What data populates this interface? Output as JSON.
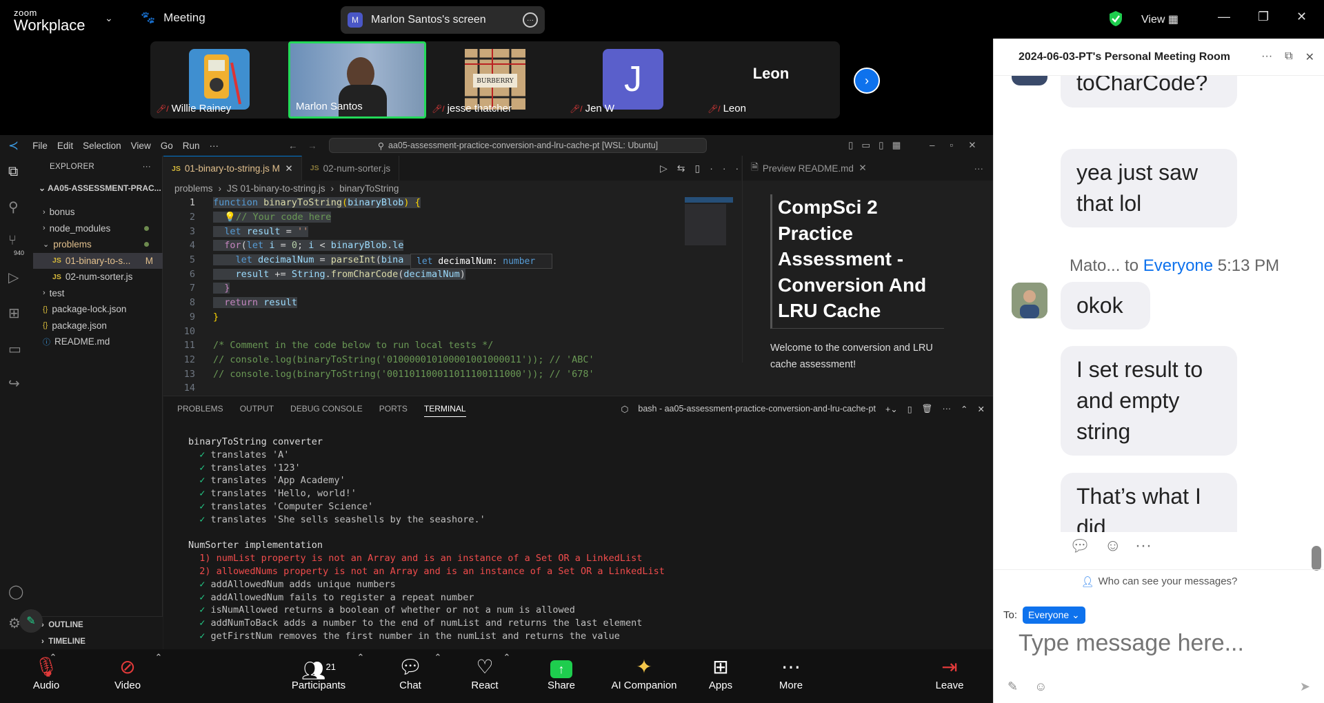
{
  "zoom": {
    "brand_top": "zoom",
    "brand_bottom": "Workplace",
    "meeting_label": "Meeting",
    "share_label": "Marlon Santos's screen",
    "share_avatar": "M",
    "view_label": "View"
  },
  "participants": [
    {
      "name": "Willie Rainey",
      "muted": true
    },
    {
      "name": "Marlon Santos",
      "muted": false
    },
    {
      "name": "jesse thatcher",
      "muted": true
    },
    {
      "name": "Jen W",
      "muted": true,
      "initial": "J"
    },
    {
      "name": "Leon",
      "muted": true,
      "tile_text": "Leon"
    }
  ],
  "vscode": {
    "menu": [
      "File",
      "Edit",
      "Selection",
      "View",
      "Go",
      "Run",
      "···"
    ],
    "search": "aa05-assessment-practice-conversion-and-lru-cache-pt [WSL: Ubuntu]",
    "explorer_title": "EXPLORER",
    "root": "AA05-ASSESSMENT-PRAC...",
    "tree": [
      {
        "label": "bonus",
        "icon": "›",
        "indent": 14
      },
      {
        "label": "node_modules",
        "icon": "›",
        "indent": 14,
        "dot": true
      },
      {
        "label": "problems",
        "icon": "⌄",
        "indent": 14,
        "dot": true,
        "color": "#e2c08d"
      },
      {
        "label": "01-binary-to-s...",
        "icon": "JS",
        "indent": 28,
        "badge": "M",
        "selected": true,
        "color": "#e2c08d"
      },
      {
        "label": "02-num-sorter.js",
        "icon": "JS",
        "indent": 28
      },
      {
        "label": "test",
        "icon": "›",
        "indent": 14
      },
      {
        "label": "package-lock.json",
        "icon": "{}",
        "indent": 14
      },
      {
        "label": "package.json",
        "icon": "{}",
        "indent": 14
      },
      {
        "label": "README.md",
        "icon": "ⓘ",
        "indent": 14
      }
    ],
    "activity_badge": "940",
    "outline": "OUTLINE",
    "timeline": "TIMELINE",
    "tab_active": "01-binary-to-string.js",
    "tab_active_badge": "M",
    "tab_other": "02-num-sorter.js",
    "breadcrumbs": [
      "problems",
      "JS 01-binary-to-string.js",
      "binaryToString"
    ],
    "hover_kw": "let",
    "hover_name": "decimalNum",
    "hover_type": "number",
    "preview_tab": "Preview README.md",
    "preview_heading": "CompSci 2 Practice Assessment - Conversion And LRU Cache",
    "preview_para": "Welcome to the conversion and LRU cache assessment!",
    "panel_tabs": [
      "PROBLEMS",
      "OUTPUT",
      "DEBUG CONSOLE",
      "PORTS",
      "TERMINAL"
    ],
    "terminal_name": "bash - aa05-assessment-practice-conversion-and-lru-cache-pt",
    "terminal": [
      {
        "t": "binaryToString converter",
        "k": "h"
      },
      {
        "t": "  ✓ translates 'A'",
        "k": "ok"
      },
      {
        "t": "  ✓ translates '123'",
        "k": "ok"
      },
      {
        "t": "  ✓ translates 'App Academy'",
        "k": "ok"
      },
      {
        "t": "  ✓ translates 'Hello, world!'",
        "k": "ok"
      },
      {
        "t": "  ✓ translates 'Computer Science'",
        "k": "ok"
      },
      {
        "t": "  ✓ translates 'She sells seashells by the seashore.'",
        "k": "ok"
      },
      {
        "t": "",
        "k": "h"
      },
      {
        "t": "NumSorter implementation",
        "k": "h"
      },
      {
        "t": "  1) numList property is not an Array and is an instance of a Set OR a LinkedList",
        "k": "fail"
      },
      {
        "t": "  2) allowedNums property is not an Array and is an instance of a Set OR a LinkedList",
        "k": "fail"
      },
      {
        "t": "  ✓ addAllowedNum adds unique numbers",
        "k": "ok"
      },
      {
        "t": "  ✓ addAllowedNum fails to register a repeat number",
        "k": "ok"
      },
      {
        "t": "  ✓ isNumAllowed returns a boolean of whether or not a num is allowed",
        "k": "ok"
      },
      {
        "t": "  ✓ addNumToBack adds a number to the end of numList and returns the last element",
        "k": "ok"
      },
      {
        "t": "  ✓ getFirstNum removes the first number in the numList and returns the value",
        "k": "ok"
      }
    ]
  },
  "chat": {
    "title": "2024-06-03-PT's Personal Meeting Room",
    "partial_top": "toCharCode?",
    "msg1": "yea just saw that lol",
    "sender": "Mato...",
    "to_word": "to",
    "to_target": "Everyone",
    "time": "5:13 PM",
    "msg2": "okok",
    "msg3": "I set result to and empty string",
    "msg4": "That’s what I did",
    "who_can_see": "Who can see your messages?",
    "to_label": "To:",
    "to_value": "Everyone",
    "placeholder": "Type message here..."
  },
  "toolbar": {
    "audio": "Audio",
    "video": "Video",
    "participants": "Participants",
    "participants_count": "21",
    "chat": "Chat",
    "react": "React",
    "share": "Share",
    "ai": "AI Companion",
    "apps": "Apps",
    "more": "More",
    "leave": "Leave"
  }
}
